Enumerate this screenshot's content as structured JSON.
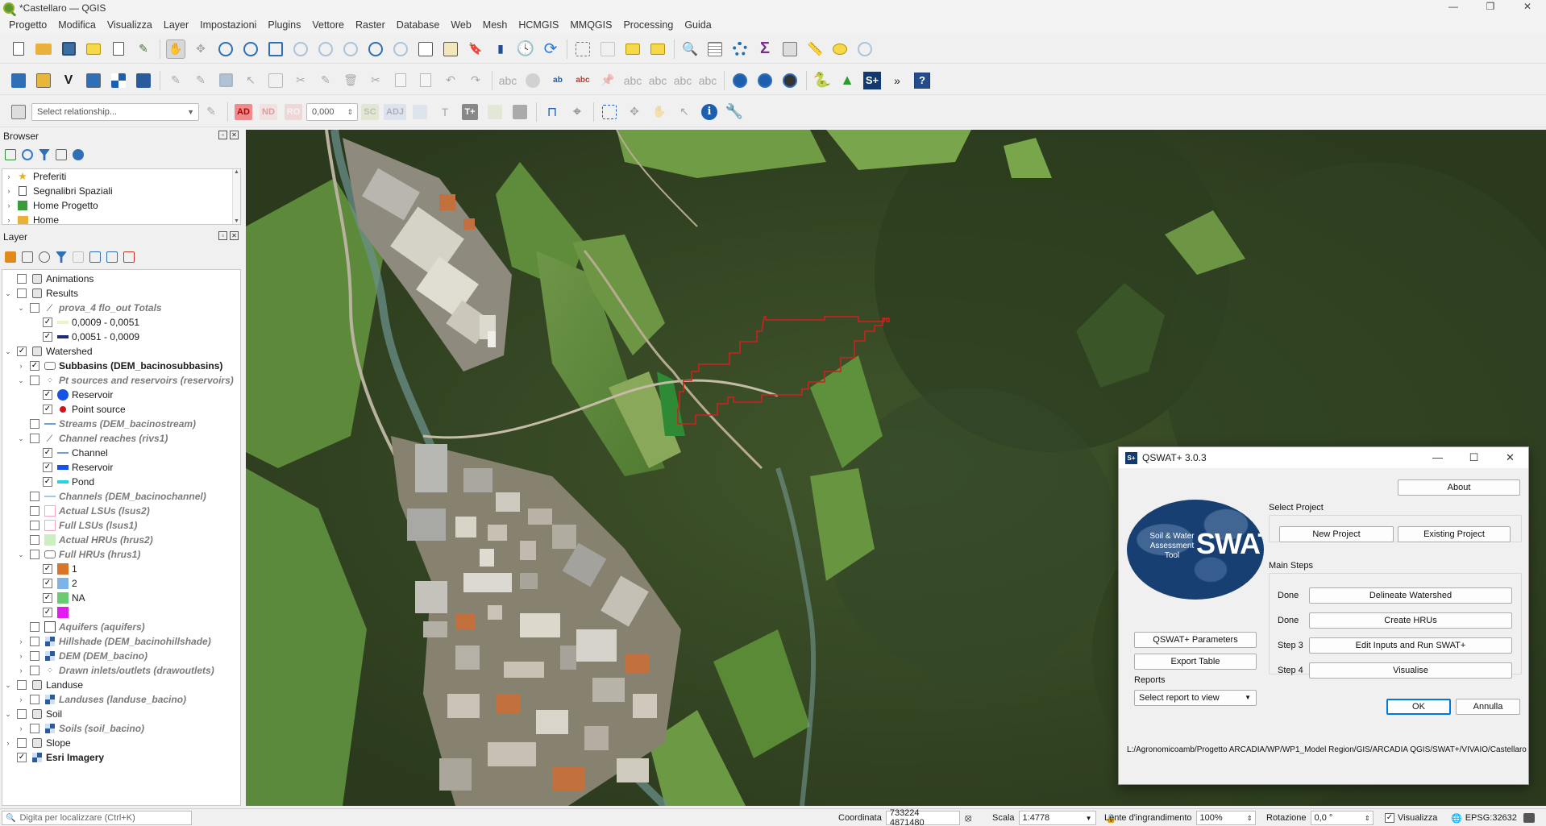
{
  "window": {
    "title": "*Castellaro — QGIS",
    "controls": [
      "—",
      "❐",
      "✕"
    ]
  },
  "menu": [
    "Progetto",
    "Modifica",
    "Visualizza",
    "Layer",
    "Impostazioni",
    "Plugins",
    "Vettore",
    "Raster",
    "Database",
    "Web",
    "Mesh",
    "HCMGIS",
    "MMQGIS",
    "Processing",
    "Guida"
  ],
  "toolbar3": {
    "relationship_placeholder": "Select relationship...",
    "ad": "AD",
    "nd": "ND",
    "ro": "RO",
    "value": "0,000",
    "sc": "SC",
    "adj": "ADJ"
  },
  "browser": {
    "title": "Browser",
    "items": [
      {
        "label": "Preferiti",
        "icon": "star-icon"
      },
      {
        "label": "Segnalibri Spaziali",
        "icon": "bookmarks-icon"
      },
      {
        "label": "Home Progetto",
        "icon": "project-home-icon"
      },
      {
        "label": "Home",
        "icon": "folder-icon"
      }
    ]
  },
  "layers": {
    "title": "Layer",
    "items": [
      {
        "label": "Animations",
        "level": 0,
        "expander": "",
        "checked": false,
        "icon": "group",
        "style": "normal"
      },
      {
        "label": "Results",
        "level": 0,
        "expander": "v",
        "checked": false,
        "icon": "group",
        "style": "normal"
      },
      {
        "label": "prova_4 flo_out Totals",
        "level": 1,
        "expander": "v",
        "checked": false,
        "icon": "line",
        "style": "gray"
      },
      {
        "label": "0,0009 - 0,0051",
        "level": 2,
        "expander": "",
        "checked": true,
        "icon": "sym-pale",
        "style": "normal"
      },
      {
        "label": "0,0051 - 0,0009",
        "level": 2,
        "expander": "",
        "checked": true,
        "icon": "sym-navy",
        "style": "normal"
      },
      {
        "label": "Watershed",
        "level": 0,
        "expander": "v",
        "checked": true,
        "icon": "group",
        "style": "normal"
      },
      {
        "label": "Subbasins (DEM_bacinosubbasins)",
        "level": 1,
        "expander": ">",
        "checked": true,
        "icon": "polygon",
        "style": "bold"
      },
      {
        "label": "Pt sources and reservoirs (reservoirs)",
        "level": 1,
        "expander": "v",
        "checked": false,
        "icon": "points",
        "style": "gray"
      },
      {
        "label": "Reservoir",
        "level": 2,
        "expander": "",
        "checked": true,
        "icon": "sym-blue-dot",
        "style": "normal"
      },
      {
        "label": "Point source",
        "level": 2,
        "expander": "",
        "checked": true,
        "icon": "sym-red-dot",
        "style": "normal"
      },
      {
        "label": "Streams (DEM_bacinostream)",
        "level": 1,
        "expander": "",
        "checked": false,
        "icon": "sym-line-blue",
        "style": "gray"
      },
      {
        "label": "Channel reaches (rivs1)",
        "level": 1,
        "expander": "v",
        "checked": false,
        "icon": "line",
        "style": "gray"
      },
      {
        "label": "Channel",
        "level": 2,
        "expander": "",
        "checked": true,
        "icon": "sym-line-blue",
        "style": "normal"
      },
      {
        "label": "Reservoir",
        "level": 2,
        "expander": "",
        "checked": true,
        "icon": "sym-blue-bar",
        "style": "normal"
      },
      {
        "label": "Pond",
        "level": 2,
        "expander": "",
        "checked": true,
        "icon": "sym-cyan-bar",
        "style": "normal"
      },
      {
        "label": "Channels (DEM_bacinochannel)",
        "level": 1,
        "expander": "",
        "checked": false,
        "icon": "sym-line-lightblue",
        "style": "gray"
      },
      {
        "label": "Actual LSUs (lsus2)",
        "level": 1,
        "expander": "",
        "checked": false,
        "icon": "sym-pink-outline",
        "style": "gray"
      },
      {
        "label": "Full LSUs (lsus1)",
        "level": 1,
        "expander": "",
        "checked": false,
        "icon": "sym-pink-outline",
        "style": "gray"
      },
      {
        "label": "Actual HRUs (hrus2)",
        "level": 1,
        "expander": "",
        "checked": false,
        "icon": "sym-lightgreen",
        "style": "gray"
      },
      {
        "label": "Full HRUs (hrus1)",
        "level": 1,
        "expander": "v",
        "checked": false,
        "icon": "polygon",
        "style": "gray"
      },
      {
        "label": "1",
        "level": 2,
        "expander": "",
        "checked": true,
        "icon": "sym-orange",
        "style": "normal"
      },
      {
        "label": "2",
        "level": 2,
        "expander": "",
        "checked": true,
        "icon": "sym-lightblue",
        "style": "normal"
      },
      {
        "label": "NA",
        "level": 2,
        "expander": "",
        "checked": true,
        "icon": "sym-green",
        "style": "normal"
      },
      {
        "label": "",
        "level": 2,
        "expander": "",
        "checked": true,
        "icon": "sym-magenta",
        "style": "normal"
      },
      {
        "label": "Aquifers (aquifers)",
        "level": 1,
        "expander": "",
        "checked": false,
        "icon": "sym-white-outline",
        "style": "gray"
      },
      {
        "label": "Hillshade (DEM_bacinohillshade)",
        "level": 1,
        "expander": ">",
        "checked": false,
        "icon": "raster",
        "style": "gray"
      },
      {
        "label": "DEM (DEM_bacino)",
        "level": 1,
        "expander": ">",
        "checked": false,
        "icon": "raster",
        "style": "gray"
      },
      {
        "label": "Drawn inlets/outlets (drawoutlets)",
        "level": 1,
        "expander": ">",
        "checked": false,
        "icon": "points",
        "style": "gray"
      },
      {
        "label": "Landuse",
        "level": 0,
        "expander": "v",
        "checked": false,
        "icon": "group",
        "style": "normal"
      },
      {
        "label": "Landuses (landuse_bacino)",
        "level": 1,
        "expander": ">",
        "checked": false,
        "icon": "raster",
        "style": "gray"
      },
      {
        "label": "Soil",
        "level": 0,
        "expander": "v",
        "checked": false,
        "icon": "group",
        "style": "normal"
      },
      {
        "label": "Soils (soil_bacino)",
        "level": 1,
        "expander": ">",
        "checked": false,
        "icon": "raster",
        "style": "gray"
      },
      {
        "label": "Slope",
        "level": 0,
        "expander": ">",
        "checked": false,
        "icon": "group",
        "style": "normal"
      },
      {
        "label": "Esri Imagery",
        "level": 0,
        "expander": "",
        "checked": true,
        "icon": "raster",
        "style": "bold"
      }
    ]
  },
  "qswat": {
    "title": "QSWAT+ 3.0.3",
    "about": "About",
    "select_project": "Select Project",
    "new_project": "New Project",
    "existing_project": "Existing Project",
    "main_steps": "Main Steps",
    "logo_small": "Soil & Water Assessment Tool",
    "logo_big": "SWAT",
    "steps": [
      {
        "status": "Done",
        "label": "Delineate Watershed"
      },
      {
        "status": "Done",
        "label": "Create HRUs"
      },
      {
        "status": "Step 3",
        "label": "Edit Inputs and Run SWAT+"
      },
      {
        "status": "Step 4",
        "label": "Visualise"
      }
    ],
    "params": "QSWAT+ Parameters",
    "export": "Export Table",
    "reports_label": "Reports",
    "reports_value": "Select report to view",
    "ok": "OK",
    "cancel": "Annulla",
    "path": "L:/Agronomicoamb/Progetto ARCADIA/WP/WP1_Model Region/GIS/ARCADIA QGIS/SWAT+/VIVAIO/Castellaro"
  },
  "status": {
    "locator_placeholder": "Digita per localizzare (Ctrl+K)",
    "coord_label": "Coordinata",
    "coord_value": "733224  4871480",
    "scale_label": "Scala",
    "scale_value": "1:4778",
    "magnifier_label": "Lente d'ingrandimento",
    "magnifier_value": "100%",
    "rotation_label": "Rotazione",
    "rotation_value": "0,0 °",
    "render_label": "Visualizza",
    "crs": "EPSG:32632"
  }
}
